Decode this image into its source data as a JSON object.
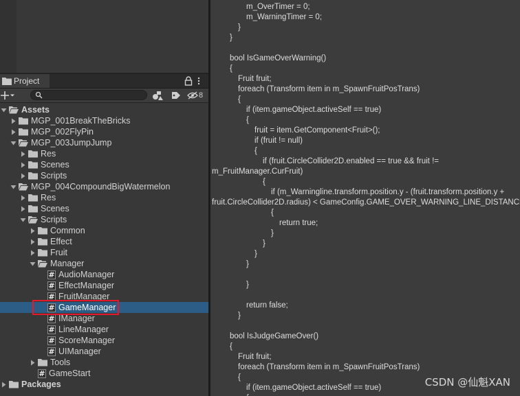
{
  "panel": {
    "tab_label": "Project",
    "hidden_count": "8",
    "search_value": ""
  },
  "tree": [
    {
      "label": "Assets",
      "depth": 0,
      "type": "folder",
      "expanded": true,
      "bold": true
    },
    {
      "label": "MGP_001BreakTheBricks",
      "depth": 1,
      "type": "folder",
      "expanded": false
    },
    {
      "label": "MGP_002FlyPin",
      "depth": 1,
      "type": "folder",
      "expanded": false
    },
    {
      "label": "MGP_003JumpJump",
      "depth": 1,
      "type": "folder",
      "expanded": true
    },
    {
      "label": "Res",
      "depth": 2,
      "type": "folder",
      "expanded": false
    },
    {
      "label": "Scenes",
      "depth": 2,
      "type": "folder",
      "expanded": false
    },
    {
      "label": "Scripts",
      "depth": 2,
      "type": "folder",
      "expanded": false
    },
    {
      "label": "MGP_004CompoundBigWatermelon",
      "depth": 1,
      "type": "folder",
      "expanded": true
    },
    {
      "label": "Res",
      "depth": 2,
      "type": "folder",
      "expanded": false
    },
    {
      "label": "Scenes",
      "depth": 2,
      "type": "folder",
      "expanded": false
    },
    {
      "label": "Scripts",
      "depth": 2,
      "type": "folder",
      "expanded": true
    },
    {
      "label": "Common",
      "depth": 3,
      "type": "folder",
      "expanded": false
    },
    {
      "label": "Effect",
      "depth": 3,
      "type": "folder",
      "expanded": false
    },
    {
      "label": "Fruit",
      "depth": 3,
      "type": "folder",
      "expanded": false
    },
    {
      "label": "Manager",
      "depth": 3,
      "type": "folder",
      "expanded": true
    },
    {
      "label": "AudioManager",
      "depth": 4,
      "type": "script"
    },
    {
      "label": "EffectManager",
      "depth": 4,
      "type": "script"
    },
    {
      "label": "FruitManager",
      "depth": 4,
      "type": "script"
    },
    {
      "label": "GameManager",
      "depth": 4,
      "type": "script",
      "selected": true
    },
    {
      "label": "IManager",
      "depth": 4,
      "type": "script"
    },
    {
      "label": "LineManager",
      "depth": 4,
      "type": "script"
    },
    {
      "label": "ScoreManager",
      "depth": 4,
      "type": "script"
    },
    {
      "label": "UIManager",
      "depth": 4,
      "type": "script"
    },
    {
      "label": "Tools",
      "depth": 3,
      "type": "folder",
      "expanded": false
    },
    {
      "label": "GameStart",
      "depth": 3,
      "type": "script"
    },
    {
      "label": "Packages",
      "depth": 0,
      "type": "folder",
      "expanded": false,
      "bold": true
    }
  ],
  "code": [
    {
      "text": "m_OverTimer = 0;",
      "indent": 3
    },
    {
      "text": "m_WarningTimer = 0;",
      "indent": 3
    },
    {
      "text": "}",
      "indent": 2
    },
    {
      "text": "}",
      "indent": 1
    },
    {
      "text": "",
      "indent": 0
    },
    {
      "text": "bool IsGameOverWarning()",
      "indent": 1
    },
    {
      "text": "{",
      "indent": 1
    },
    {
      "text": "Fruit fruit;",
      "indent": 2
    },
    {
      "text": "foreach (Transform item in m_SpawnFruitPosTrans)",
      "indent": 2
    },
    {
      "text": "{",
      "indent": 2
    },
    {
      "text": "if (item.gameObject.activeSelf == true)",
      "indent": 3
    },
    {
      "text": "{",
      "indent": 3
    },
    {
      "text": "fruit = item.GetComponent<Fruit>();",
      "indent": 4
    },
    {
      "text": "if (fruit != null)",
      "indent": 4
    },
    {
      "text": "{",
      "indent": 4
    },
    {
      "text": "if (fruit.CircleCollider2D.enabled == true && fruit !=",
      "indent": 5
    },
    {
      "text": "m_FruitManager.CurFruit)",
      "indent": 0
    },
    {
      "text": "{",
      "indent": 5
    },
    {
      "text": "if (m_Warningline.transform.position.y - (fruit.transform.position.y +",
      "indent": 6
    },
    {
      "text": "fruit.CircleCollider2D.radius) < GameConfig.GAME_OVER_WARNING_LINE_DISTANCE)",
      "indent": 0
    },
    {
      "text": "{",
      "indent": 6
    },
    {
      "text": "return true;",
      "indent": 7
    },
    {
      "text": "}",
      "indent": 6
    },
    {
      "text": "}",
      "indent": 5
    },
    {
      "text": "}",
      "indent": 4
    },
    {
      "text": "}",
      "indent": 3
    },
    {
      "text": "",
      "indent": 0
    },
    {
      "text": "}",
      "indent": 3
    },
    {
      "text": "",
      "indent": 0
    },
    {
      "text": "return false;",
      "indent": 3
    },
    {
      "text": "}",
      "indent": 2
    },
    {
      "text": "",
      "indent": 0
    },
    {
      "text": "bool IsJudgeGameOver()",
      "indent": 1
    },
    {
      "text": "{",
      "indent": 1
    },
    {
      "text": "Fruit fruit;",
      "indent": 2
    },
    {
      "text": "foreach (Transform item in m_SpawnFruitPosTrans)",
      "indent": 2
    },
    {
      "text": "{",
      "indent": 2
    },
    {
      "text": "if (item.gameObject.activeSelf == true)",
      "indent": 3
    },
    {
      "text": "{",
      "indent": 3
    }
  ],
  "watermark": "CSDN @仙魁XAN",
  "colors": {
    "selection": "#2c5d87",
    "highlight_box": "#e8182a",
    "folder": "#c2c2c2",
    "panel_bg": "#383838",
    "code_bg": "#3c3c3c"
  }
}
